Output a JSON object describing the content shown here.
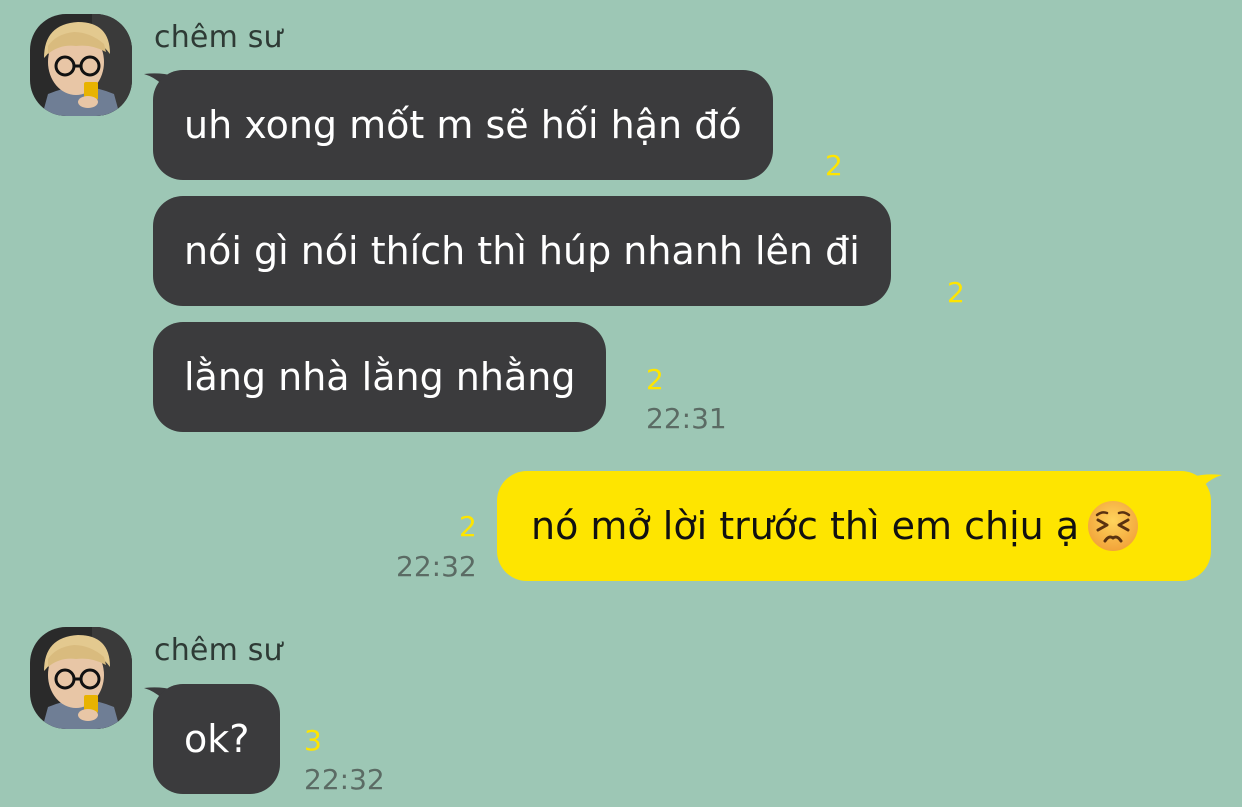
{
  "chat": {
    "colors": {
      "background": "#9dc7b5",
      "incoming_bubble": "#3b3b3d",
      "outgoing_bubble": "#fee500",
      "unread_count": "#fee500"
    },
    "messages": [
      {
        "sender": "chêm sư",
        "avatar_icon": "user-avatar",
        "items": [
          {
            "text": "uh xong mốt m sẽ hối hận đó",
            "unread": "2",
            "time": ""
          },
          {
            "text": "nói gì nói thích thì húp nhanh lên đi",
            "unread": "2",
            "time": ""
          },
          {
            "text": "lằng nhà lằng nhằng",
            "unread": "2",
            "time": "22:31"
          }
        ]
      },
      {
        "sender": "",
        "outgoing": true,
        "items": [
          {
            "text": "nó mở lời trước thì em chịu ạ",
            "emoji": "persevering-face-emoji",
            "unread": "2",
            "time": "22:32"
          }
        ]
      },
      {
        "sender": "chêm sư",
        "avatar_icon": "user-avatar",
        "items": [
          {
            "text": "ok?",
            "unread": "3",
            "time": "22:32"
          }
        ]
      }
    ]
  }
}
